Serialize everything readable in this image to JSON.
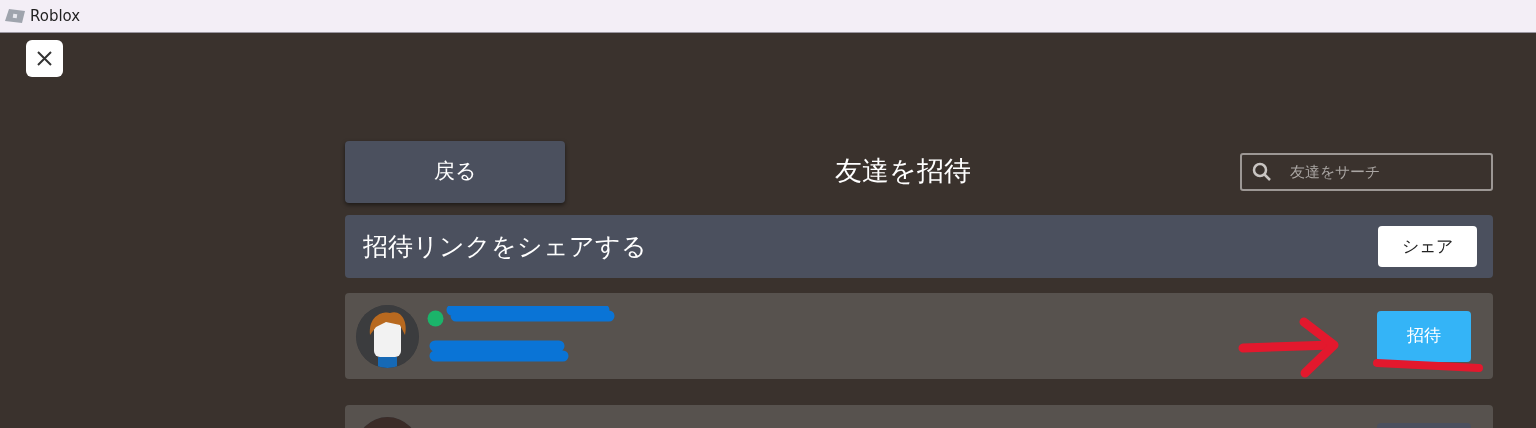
{
  "window": {
    "title": "Roblox"
  },
  "header": {
    "back_button": "戻る",
    "title": "友達を招待",
    "search": {
      "placeholder": "友達をサーチ"
    }
  },
  "share_row": {
    "label": "招待リンクをシェアする",
    "button": "シェア"
  },
  "friends": [
    {
      "online": true,
      "name_redacted": true,
      "button": "招待",
      "button_highlighted": true
    },
    {
      "button_highlighted": false
    }
  ],
  "arrow_annotation": {
    "color": "#e3182d"
  },
  "underline_annotation": {
    "color": "#e3182d"
  }
}
